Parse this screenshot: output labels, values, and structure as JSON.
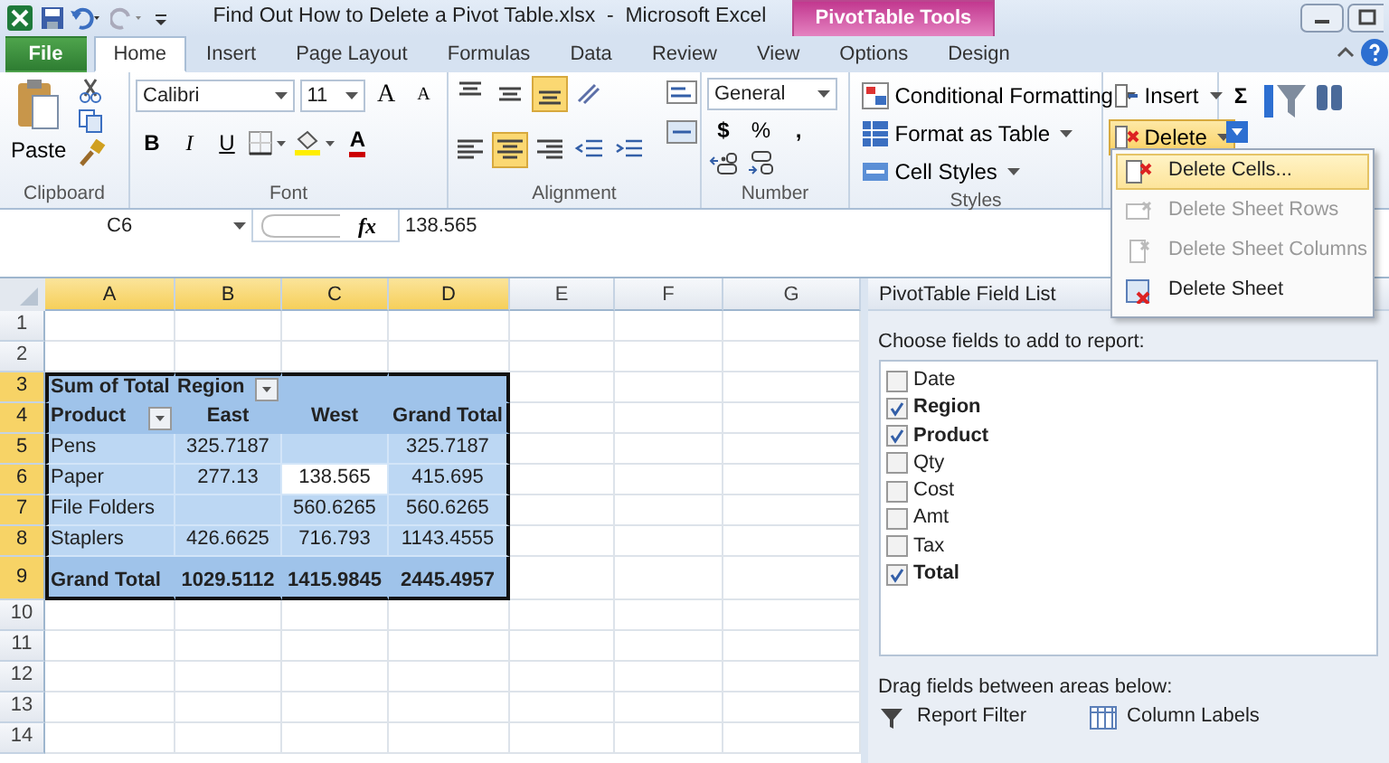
{
  "window": {
    "title": "Find Out How to Delete a Pivot Table.xlsx  -  Microsoft Excel",
    "context_tab": "PivotTable Tools"
  },
  "tabs": [
    {
      "label": "File",
      "kind": "file",
      "selected": false
    },
    {
      "label": "Home",
      "kind": "normal",
      "selected": true
    },
    {
      "label": "Insert",
      "kind": "normal",
      "selected": false
    },
    {
      "label": "Page Layout",
      "kind": "normal",
      "selected": false
    },
    {
      "label": "Formulas",
      "kind": "normal",
      "selected": false
    },
    {
      "label": "Data",
      "kind": "normal",
      "selected": false
    },
    {
      "label": "Review",
      "kind": "normal",
      "selected": false
    },
    {
      "label": "View",
      "kind": "normal",
      "selected": false
    },
    {
      "label": "Options",
      "kind": "contextual",
      "selected": false
    },
    {
      "label": "Design",
      "kind": "contextual",
      "selected": false
    }
  ],
  "ribbon": {
    "clipboard": {
      "label": "Clipboard",
      "paste": "Paste"
    },
    "font": {
      "label": "Font",
      "face": "Calibri",
      "size": "11",
      "grow": "A",
      "shrink": "A",
      "bold": "B",
      "italic": "I",
      "underline": "U",
      "font_color": "A"
    },
    "alignment": {
      "label": "Alignment",
      "buttons": [
        {
          "kind": "top",
          "selected": false
        },
        {
          "kind": "middle",
          "selected": false
        },
        {
          "kind": "bottom",
          "selected": true
        },
        {
          "kind": "orient",
          "selected": false
        },
        {
          "kind": "left",
          "selected": false
        },
        {
          "kind": "center",
          "selected": true
        },
        {
          "kind": "right",
          "selected": false
        },
        {
          "kind": "outdent",
          "selected": false
        },
        {
          "kind": "indent",
          "selected": false
        }
      ]
    },
    "number": {
      "label": "Number",
      "format": "General",
      "currency": "$",
      "percent": "%",
      "comma": ","
    },
    "styles": {
      "label": "Styles",
      "items": [
        "Conditional Formatting",
        "Format as Table",
        "Cell Styles"
      ]
    },
    "cells": {
      "insert": "Insert",
      "delete": "Delete",
      "delete_open": true
    },
    "editing": {
      "sum": "Σ"
    }
  },
  "delete_menu": [
    {
      "label": "Delete Cells...",
      "selected": true,
      "disabled": false
    },
    {
      "label": "Delete Sheet Rows",
      "selected": false,
      "disabled": true
    },
    {
      "label": "Delete Sheet Columns",
      "selected": false,
      "disabled": true
    },
    {
      "label": "Delete Sheet",
      "selected": false,
      "disabled": false
    }
  ],
  "formula_bar": {
    "name_box": "C6",
    "fx": "fx",
    "value": "138.565"
  },
  "sheet": {
    "columns": [
      {
        "label": "A",
        "highlighted": true
      },
      {
        "label": "B",
        "highlighted": true
      },
      {
        "label": "C",
        "highlighted": true
      },
      {
        "label": "D",
        "highlighted": true
      },
      {
        "label": "E",
        "highlighted": false
      },
      {
        "label": "F",
        "highlighted": false
      },
      {
        "label": "G",
        "highlighted": false
      }
    ],
    "rows": [
      {
        "number": "1",
        "highlighted": false,
        "kind": "plain"
      },
      {
        "number": "2",
        "highlighted": false,
        "kind": "plain"
      },
      {
        "number": "3",
        "highlighted": true,
        "kind": "pivot_head",
        "cells": [
          {
            "kind": "value",
            "text": "Sum of Total",
            "selected": false
          },
          {
            "kind": "field",
            "text": "Region",
            "selected": false
          },
          {
            "kind": "value",
            "selected": false
          },
          {
            "kind": "value",
            "selected": false
          }
        ]
      },
      {
        "number": "4",
        "highlighted": true,
        "kind": "pivot_head",
        "cells": [
          {
            "kind": "field",
            "text": "Product",
            "selected": false
          },
          {
            "kind": "value",
            "text": "East",
            "selected": false
          },
          {
            "kind": "value",
            "text": "West",
            "selected": false
          },
          {
            "kind": "value",
            "text": "Grand Total",
            "selected": false
          }
        ]
      },
      {
        "number": "5",
        "highlighted": true,
        "kind": "pivot_body",
        "cells": [
          {
            "kind": "value",
            "text": "Pens",
            "selected": false
          },
          {
            "kind": "value",
            "text": "325.7187",
            "selected": false
          },
          {
            "kind": "value",
            "selected": false
          },
          {
            "kind": "value",
            "text": "325.7187",
            "selected": false
          }
        ]
      },
      {
        "number": "6",
        "highlighted": true,
        "kind": "pivot_body",
        "cells": [
          {
            "kind": "value",
            "text": "Paper",
            "selected": false
          },
          {
            "kind": "value",
            "text": "277.13",
            "selected": false
          },
          {
            "kind": "value",
            "text": "138.565",
            "selected": true
          },
          {
            "kind": "value",
            "text": "415.695",
            "selected": false
          }
        ]
      },
      {
        "number": "7",
        "highlighted": true,
        "kind": "pivot_body",
        "cells": [
          {
            "kind": "value",
            "text": "File Folders",
            "selected": false
          },
          {
            "kind": "value",
            "selected": false
          },
          {
            "kind": "value",
            "text": "560.6265",
            "selected": false
          },
          {
            "kind": "value",
            "text": "560.6265",
            "selected": false
          }
        ]
      },
      {
        "number": "8",
        "highlighted": true,
        "kind": "pivot_body",
        "cells": [
          {
            "kind": "value",
            "text": "Staplers",
            "selected": false
          },
          {
            "kind": "value",
            "text": "426.6625",
            "selected": false
          },
          {
            "kind": "value",
            "text": "716.793",
            "selected": false
          },
          {
            "kind": "value",
            "text": "1143.4555",
            "selected": false
          }
        ]
      },
      {
        "number": "9",
        "highlighted": true,
        "kind": "pivot_total",
        "cells": [
          {
            "kind": "value",
            "text": "Grand Total",
            "selected": false
          },
          {
            "kind": "value",
            "text": "1029.5112",
            "selected": false
          },
          {
            "kind": "value",
            "text": "1415.9845",
            "selected": false
          },
          {
            "kind": "value",
            "text": "2445.4957",
            "selected": false
          }
        ]
      },
      {
        "number": "10",
        "highlighted": false,
        "kind": "plain"
      },
      {
        "number": "11",
        "highlighted": false,
        "kind": "plain"
      },
      {
        "number": "12",
        "highlighted": false,
        "kind": "plain"
      },
      {
        "number": "13",
        "highlighted": false,
        "kind": "plain"
      },
      {
        "number": "14",
        "highlighted": false,
        "kind": "plain"
      }
    ]
  },
  "field_list": {
    "title": "PivotTable Field List",
    "prompt": "Choose fields to add to report:",
    "fields": [
      {
        "label": "Date",
        "checked": false
      },
      {
        "label": "Region",
        "checked": true
      },
      {
        "label": "Product",
        "checked": true
      },
      {
        "label": "Qty",
        "checked": false
      },
      {
        "label": "Cost",
        "checked": false
      },
      {
        "label": "Amt",
        "checked": false
      },
      {
        "label": "Tax",
        "checked": false
      },
      {
        "label": "Total",
        "checked": true
      }
    ],
    "areas_prompt": "Drag fields between areas below:",
    "areas": [
      {
        "label": "Report Filter",
        "kind": "filter"
      },
      {
        "label": "Column Labels",
        "kind": "columns"
      }
    ]
  }
}
